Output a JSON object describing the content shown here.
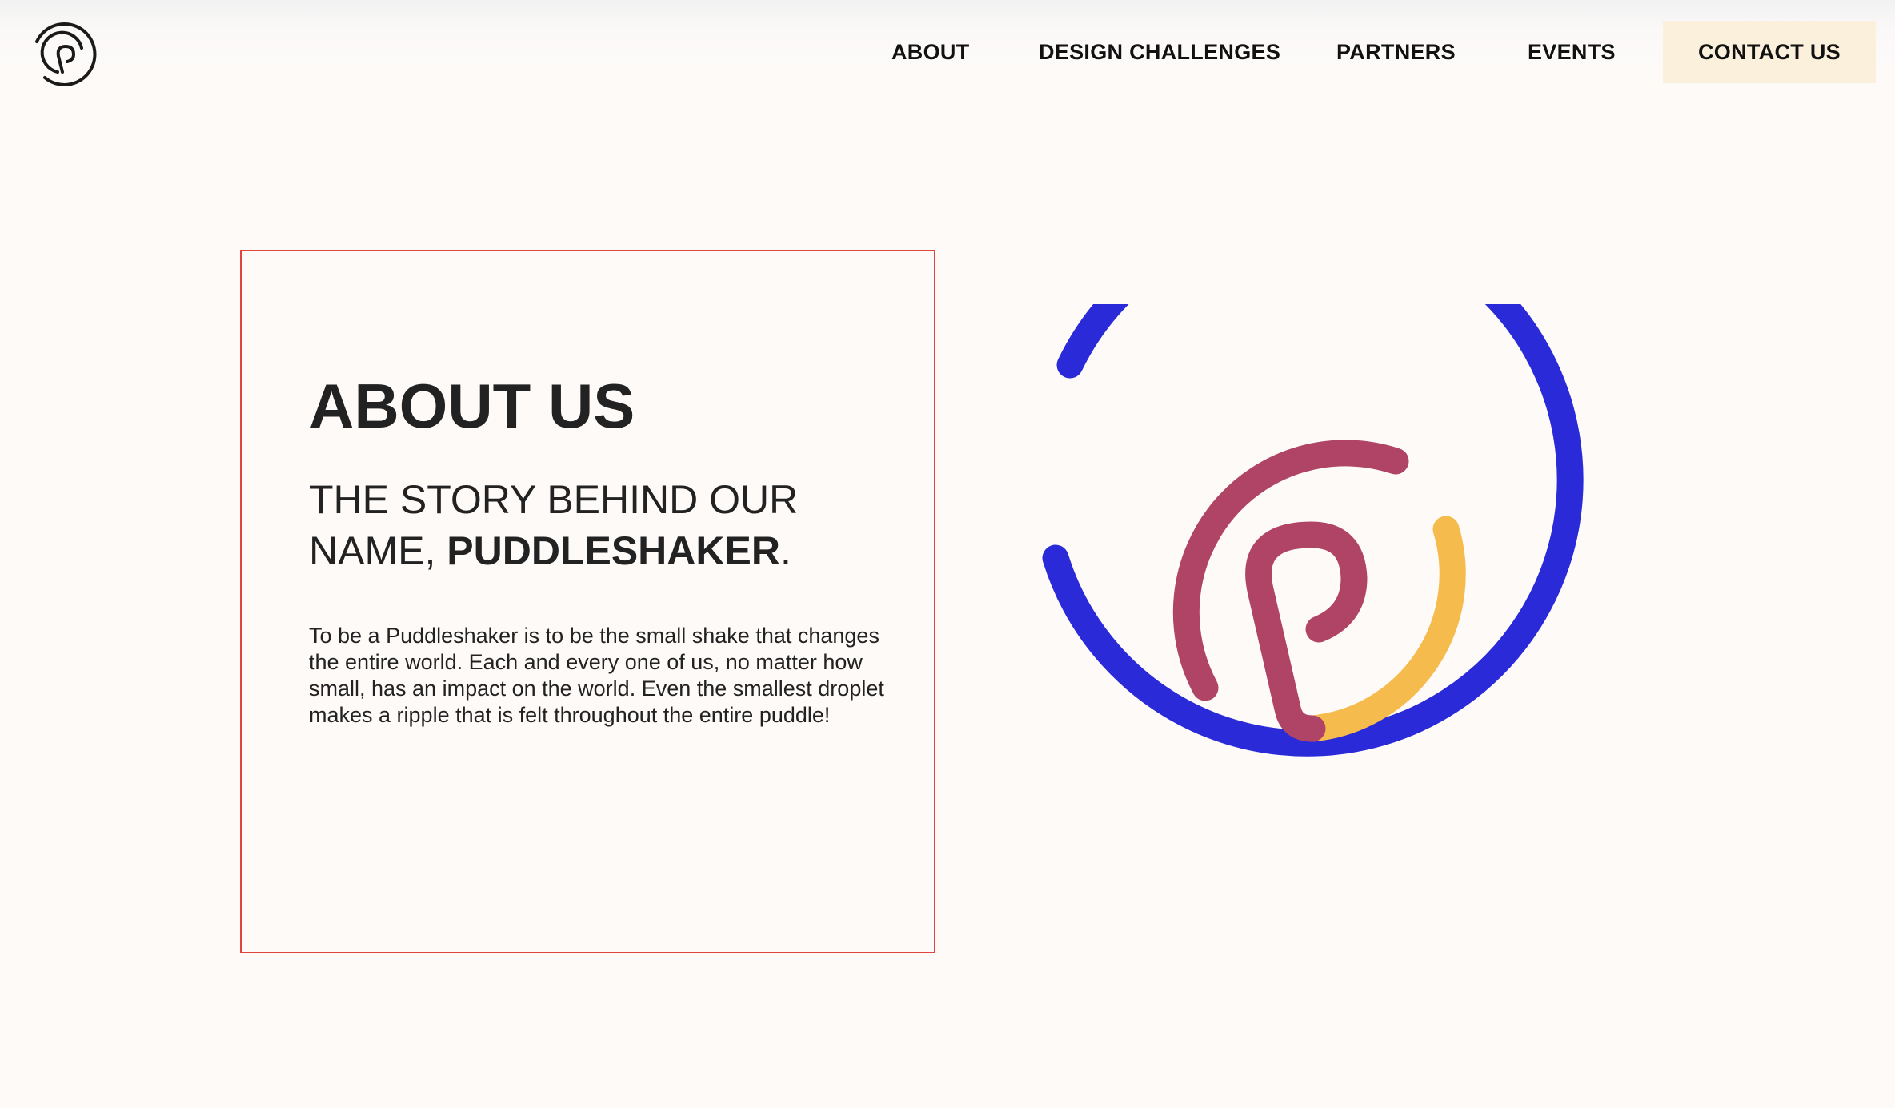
{
  "nav": {
    "about": "ABOUT",
    "design_challenges": "DESIGN CHALLENGES",
    "partners": "PARTNERS",
    "events": "EVENTS",
    "contact": "CONTACT US"
  },
  "about": {
    "title": "ABOUT US",
    "subtitle_line1": "THE STORY BEHIND OUR",
    "subtitle_prefix": "NAME, ",
    "subtitle_name": "PUDDLESHAKER",
    "subtitle_suffix": ".",
    "body": "To be a Puddleshaker is to be the small shake that changes the entire world. Each and every one of us, no matter how small, has an impact on the world. Even the smallest droplet makes a ripple that is felt throughout the entire puddle!"
  },
  "icons": {
    "logo": "puddleshaker-logo-icon",
    "emblem": "puddleshaker-emblem-icon"
  },
  "colors": {
    "background": "#fdfaf8",
    "card_border": "#e0463f",
    "contact_bg": "#fbf0dc",
    "emblem_blue": "#2a2ad8",
    "emblem_red": "#b04466",
    "emblem_yellow": "#f5bb4d",
    "text": "#222222"
  }
}
